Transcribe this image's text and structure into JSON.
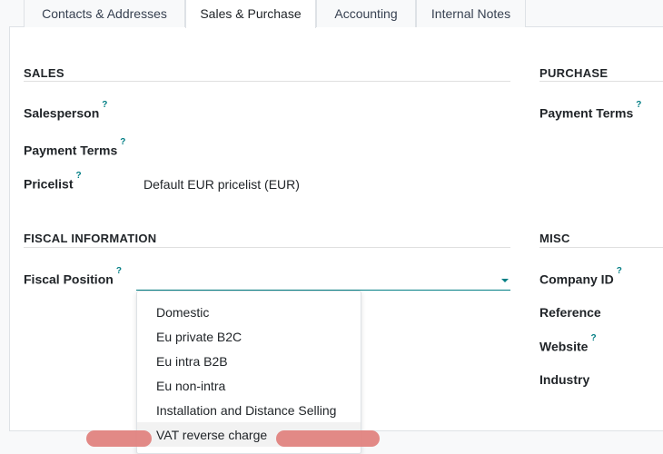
{
  "tabs": [
    {
      "label": "Contacts & Addresses",
      "active": false
    },
    {
      "label": "Sales & Purchase",
      "active": true
    },
    {
      "label": "Accounting",
      "active": false
    },
    {
      "label": "Internal Notes",
      "active": false
    }
  ],
  "help_glyph": "?",
  "sales": {
    "title": "SALES",
    "salesperson_label": "Salesperson",
    "payment_terms_label": "Payment Terms",
    "pricelist_label": "Pricelist",
    "pricelist_value": "Default EUR pricelist (EUR)"
  },
  "purchase": {
    "title": "PURCHASE",
    "payment_terms_label": "Payment Terms"
  },
  "fiscal": {
    "title": "FISCAL INFORMATION",
    "fiscal_position_label": "Fiscal Position",
    "fiscal_position_value": "",
    "options": [
      "Domestic",
      "Eu private B2C",
      "Eu intra B2B",
      "Eu non-intra",
      "Installation and Distance Selling",
      "VAT reverse charge"
    ]
  },
  "misc": {
    "title": "MISC",
    "company_id_label": "Company ID",
    "reference_label": "Reference",
    "website_label": "Website",
    "industry_label": "Industry"
  },
  "colors": {
    "accent": "#017e84",
    "redaction": "#e0837f"
  }
}
